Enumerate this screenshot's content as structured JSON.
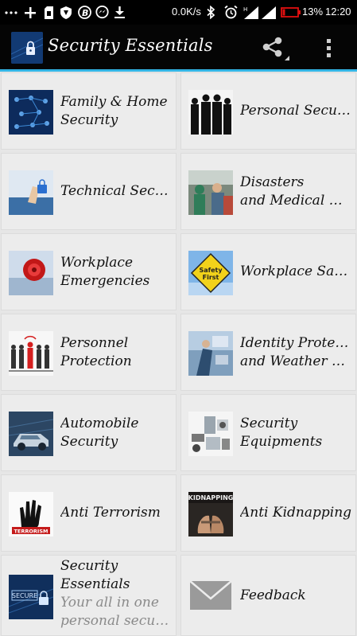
{
  "status_bar": {
    "icons": [
      "more-icon",
      "plus-icon",
      "sim-icon",
      "shield-icon",
      "b-icon",
      "messenger-icon",
      "download-icon",
      "bluetooth-icon",
      "alarm-icon",
      "signal-icon",
      "battery-icon"
    ],
    "net_speed": "0.0K/s",
    "battery": "13%",
    "time": "12:20"
  },
  "app_bar": {
    "title": "Security Essentials",
    "share_icon": "share-icon",
    "overflow_icon": "overflow-menu-icon"
  },
  "accent_color": "#33b5e5",
  "tiles": [
    {
      "id": "family-home-security",
      "lines": [
        "Family & Home",
        "Security"
      ],
      "icon": "family-home-thumb"
    },
    {
      "id": "personal-security",
      "lines": [
        "Personal Security"
      ],
      "icon": "personal-security-thumb"
    },
    {
      "id": "technical-security",
      "lines": [
        "Technical Security"
      ],
      "icon": "technical-security-thumb"
    },
    {
      "id": "disasters-medical",
      "lines": [
        "Disasters",
        "and Medical Em..."
      ],
      "icon": "disasters-thumb"
    },
    {
      "id": "workplace-emergencies",
      "lines": [
        "Workplace",
        "Emergencies"
      ],
      "icon": "fire-alarm-thumb"
    },
    {
      "id": "workplace-safety",
      "lines": [
        "Workplace Safety"
      ],
      "icon": "safety-first-sign-thumb"
    },
    {
      "id": "personnel-protection",
      "lines": [
        "Personnel",
        "Protection"
      ],
      "icon": "personnel-thumb"
    },
    {
      "id": "identity-protection",
      "lines": [
        "Identity Protection",
        "and Weather Sec..."
      ],
      "icon": "identity-thumb"
    },
    {
      "id": "automobile-security",
      "lines": [
        "Automobile",
        "Security"
      ],
      "icon": "car-thumb"
    },
    {
      "id": "security-equipments",
      "lines": [
        "Security",
        "Equipments"
      ],
      "icon": "equipment-thumb"
    },
    {
      "id": "anti-terrorism",
      "lines": [
        "Anti Terrorism"
      ],
      "icon": "terrorism-thumb",
      "thumb_text": "TERRORISM"
    },
    {
      "id": "anti-kidnapping",
      "lines": [
        "Anti Kidnapping"
      ],
      "icon": "kidnapping-thumb",
      "thumb_text": "KIDNAPPING"
    },
    {
      "id": "security-essentials",
      "lines": [
        "Security",
        "Essentials"
      ],
      "sub": [
        "Your all in one",
        "personal security"
      ],
      "icon": "secure-thumb",
      "thumb_text": "SECURE"
    },
    {
      "id": "feedback",
      "lines": [
        "Feedback"
      ],
      "icon": "envelope-icon"
    }
  ]
}
